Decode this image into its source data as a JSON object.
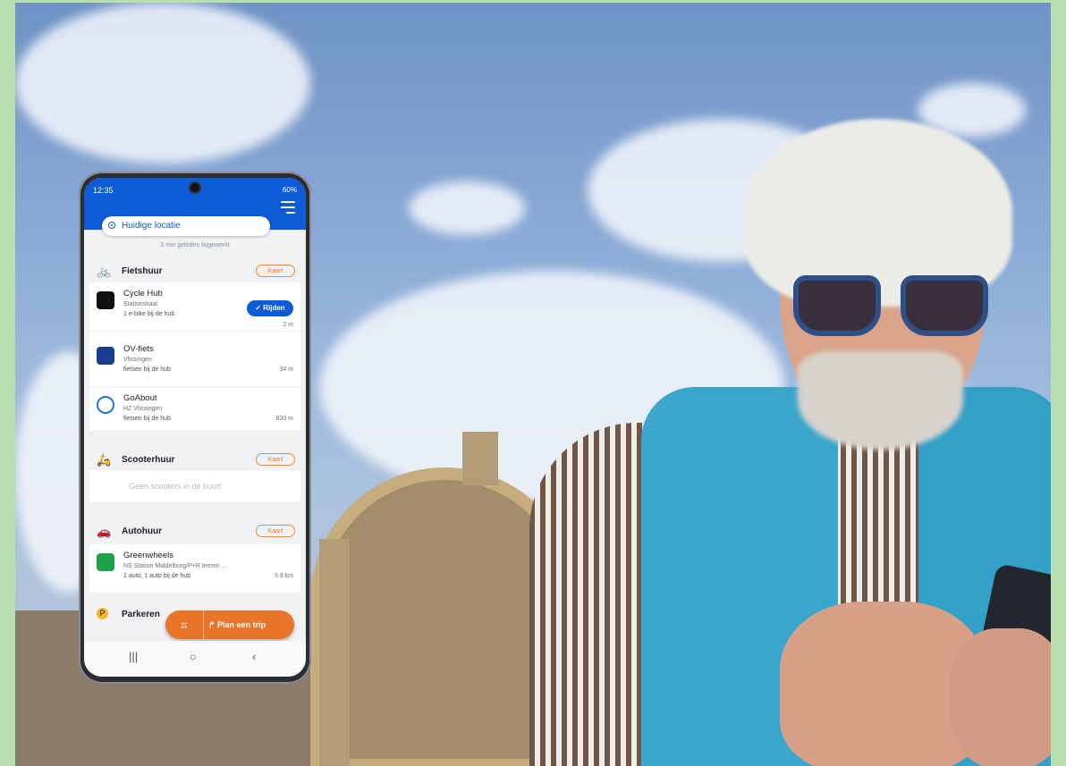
{
  "status": {
    "time": "12:35",
    "right": "60%"
  },
  "location": {
    "label": "Huidige locatie",
    "updated": "3 min geleden bijgewerkt"
  },
  "sections": {
    "bikes": {
      "title": "Fietshuur",
      "map_label": "Kaart",
      "items": [
        {
          "name": "Cycle Hub",
          "sub": "Stationskaai",
          "info": "1 e-bike bij de hub",
          "distance": "2 m",
          "action": "Rijden"
        },
        {
          "name": "OV-fiets",
          "sub": "Vlissingen",
          "info": "fietsen bij de hub",
          "distance": "34 m"
        },
        {
          "name": "GoAbout",
          "sub": "HZ Vlissingen",
          "info": "fietsen bij de hub",
          "distance": "830 m"
        }
      ]
    },
    "scooters": {
      "title": "Scooterhuur",
      "map_label": "Kaart",
      "empty": "Geen scooters in de buurt"
    },
    "cars": {
      "title": "Autohuur",
      "map_label": "Kaart",
      "items": [
        {
          "name": "Greenwheels",
          "sub": "NS Station Middelburg/P+R terrein ...",
          "info": "1 auto, 1 auto bij de hub",
          "distance": "5.9 km"
        }
      ]
    },
    "parking": {
      "title": "Parkeren"
    }
  },
  "fab": {
    "plan_label": "Plan een trip"
  },
  "colors": {
    "primary": "#0d5bd7",
    "accent": "#e8752a",
    "background": "#b9dfb0"
  }
}
